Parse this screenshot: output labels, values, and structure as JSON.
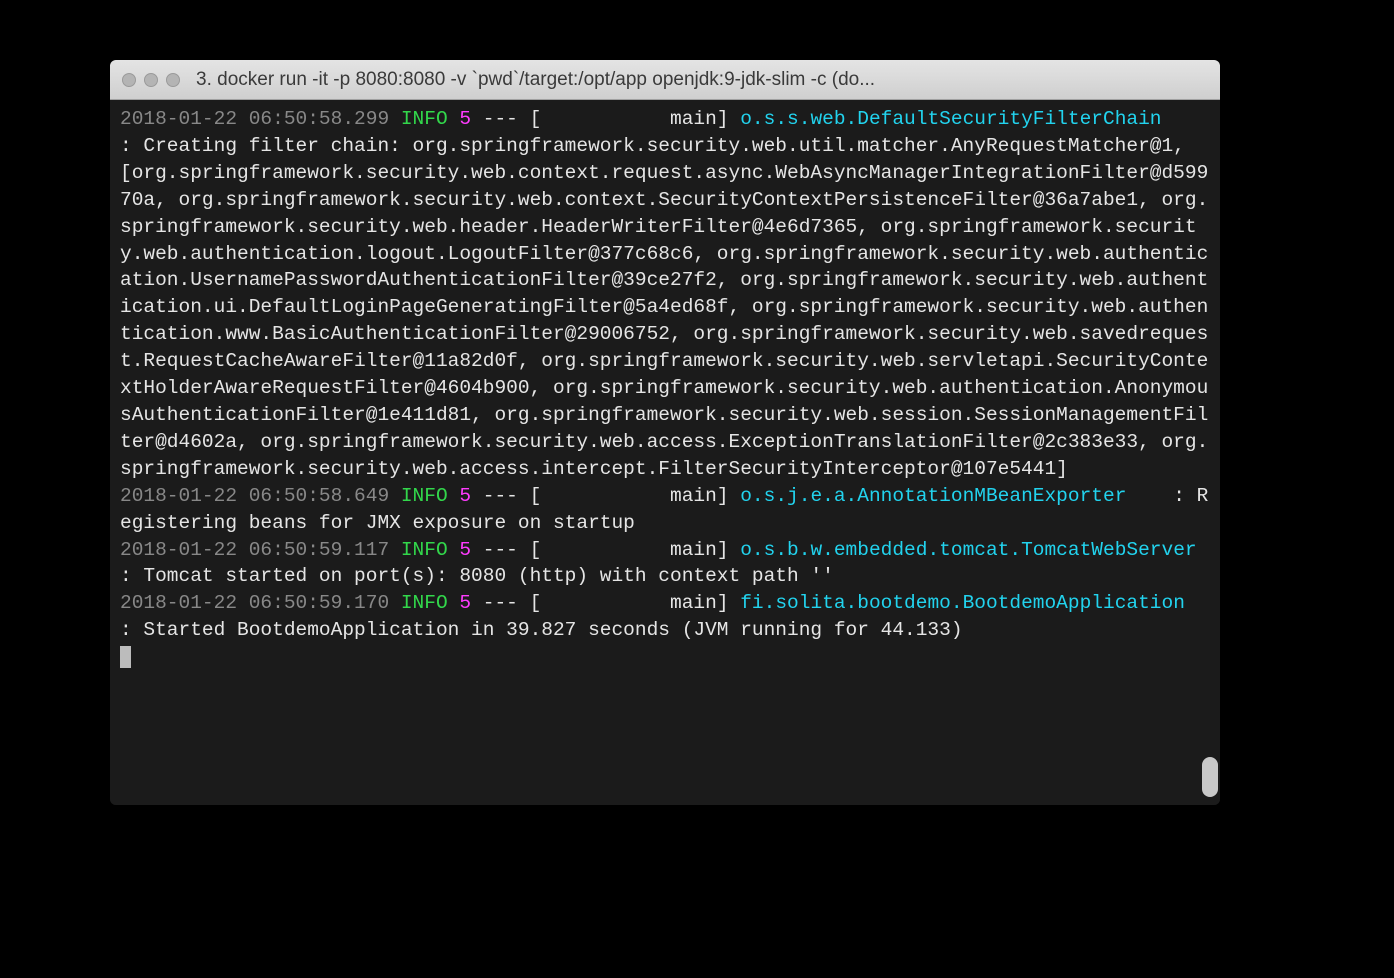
{
  "window": {
    "title": "3. docker run -it -p 8080:8080 -v `pwd`/target:/opt/app openjdk:9-jdk-slim  -c  (do..."
  },
  "log": {
    "line1": {
      "ts": "2018-01-22 06:50:58.299",
      "level": " INFO",
      "pid": "5",
      "sep": " --- [           ",
      "thread": "main",
      "logger": "o.s.s.web.DefaultSecurityFilterChain",
      "msg": "Creating filter chain: org.springframework.security.web.util.matcher.AnyRequestMatcher@1, [org.springframework.security.web.context.request.async.WebAsyncManagerIntegrationFilter@d59970a, org.springframework.security.web.context.SecurityContextPersistenceFilter@36a7abe1, org.springframework.security.web.header.HeaderWriterFilter@4e6d7365, org.springframework.security.web.authentication.logout.LogoutFilter@377c68c6, org.springframework.security.web.authentication.UsernamePasswordAuthenticationFilter@39ce27f2, org.springframework.security.web.authentication.ui.DefaultLoginPageGeneratingFilter@5a4ed68f, org.springframework.security.web.authentication.www.BasicAuthenticationFilter@29006752, org.springframework.security.web.savedrequest.RequestCacheAwareFilter@11a82d0f, org.springframework.security.web.servletapi.SecurityContextHolderAwareRequestFilter@4604b900, org.springframework.security.web.authentication.AnonymousAuthenticationFilter@1e411d81, org.springframework.security.web.session.SessionManagementFilter@d4602a, org.springframework.security.web.access.ExceptionTranslationFilter@2c383e33, org.springframework.security.web.access.intercept.FilterSecurityInterceptor@107e5441]"
    },
    "line2": {
      "ts": "2018-01-22 06:50:58.649",
      "level": " INFO",
      "pid": "5",
      "sep": " --- [           ",
      "thread": "main",
      "logger": "o.s.j.e.a.AnnotationMBeanExporter",
      "msg": "Registering beans for JMX exposure on startup"
    },
    "line3": {
      "ts": "2018-01-22 06:50:59.117",
      "level": " INFO",
      "pid": "5",
      "sep": " --- [           ",
      "thread": "main",
      "logger": "o.s.b.w.embedded.tomcat.TomcatWebServer",
      "msg": "Tomcat started on port(s): 8080 (http) with context path ''"
    },
    "line4": {
      "ts": "2018-01-22 06:50:59.170",
      "level": " INFO",
      "pid": "5",
      "sep": " --- [           ",
      "thread": "main",
      "logger": "fi.solita.bootdemo.BootdemoApplication",
      "msg": "Started BootdemoApplication in 39.827 seconds (JVM running for 44.133)"
    }
  },
  "glue": {
    "bracket_close": "] ",
    "colon": "    : "
  }
}
